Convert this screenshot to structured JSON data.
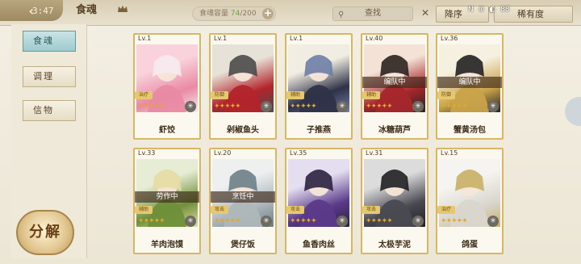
{
  "header": {
    "back_label": "3:47",
    "tab_title": "食魂",
    "capacity_label": "食魂容量",
    "capacity_current": "74",
    "capacity_total": "/200",
    "search_label": "查找",
    "sort_label": "降序",
    "filter_label": "稀有度",
    "status_icons": [
      "N",
      "⊕",
      "◐",
      "88"
    ]
  },
  "sidebar": {
    "tabs": [
      {
        "label": "食魂",
        "active": true
      },
      {
        "label": "调理",
        "active": false
      },
      {
        "label": "信物",
        "active": false
      }
    ],
    "decompose_label": "分解"
  },
  "cards": [
    {
      "level": "Lv.1",
      "name": "虾饺",
      "role": "治疗",
      "tag": "",
      "theme": "pink"
    },
    {
      "level": "Lv.1",
      "name": "剁椒鱼头",
      "role": "防御",
      "tag": "",
      "theme": "red"
    },
    {
      "level": "Lv.1",
      "name": "子推燕",
      "role": "辅助",
      "tag": "",
      "theme": "blue"
    },
    {
      "level": "Lv.40",
      "name": "冰糖葫芦",
      "role": "辅助",
      "tag": "编队中",
      "theme": "crimson"
    },
    {
      "level": "Lv.36",
      "name": "蟹黄汤包",
      "role": "防御",
      "tag": "编队中",
      "theme": "gold"
    },
    {
      "level": "Lv.33",
      "name": "羊肉泡馍",
      "role": "辅助",
      "tag": "劳作中",
      "theme": "green"
    },
    {
      "level": "Lv.20",
      "name": "煲仔饭",
      "role": "攻击",
      "tag": "烹饪中",
      "theme": "silver"
    },
    {
      "level": "Lv.35",
      "name": "鱼香肉丝",
      "role": "攻击",
      "tag": "",
      "theme": "purple"
    },
    {
      "level": "Lv.31",
      "name": "太极芋泥",
      "role": "攻击",
      "tag": "",
      "theme": "dark"
    },
    {
      "level": "Lv.15",
      "name": "鸽蛋",
      "role": "治疗",
      "tag": "",
      "theme": "white"
    }
  ]
}
